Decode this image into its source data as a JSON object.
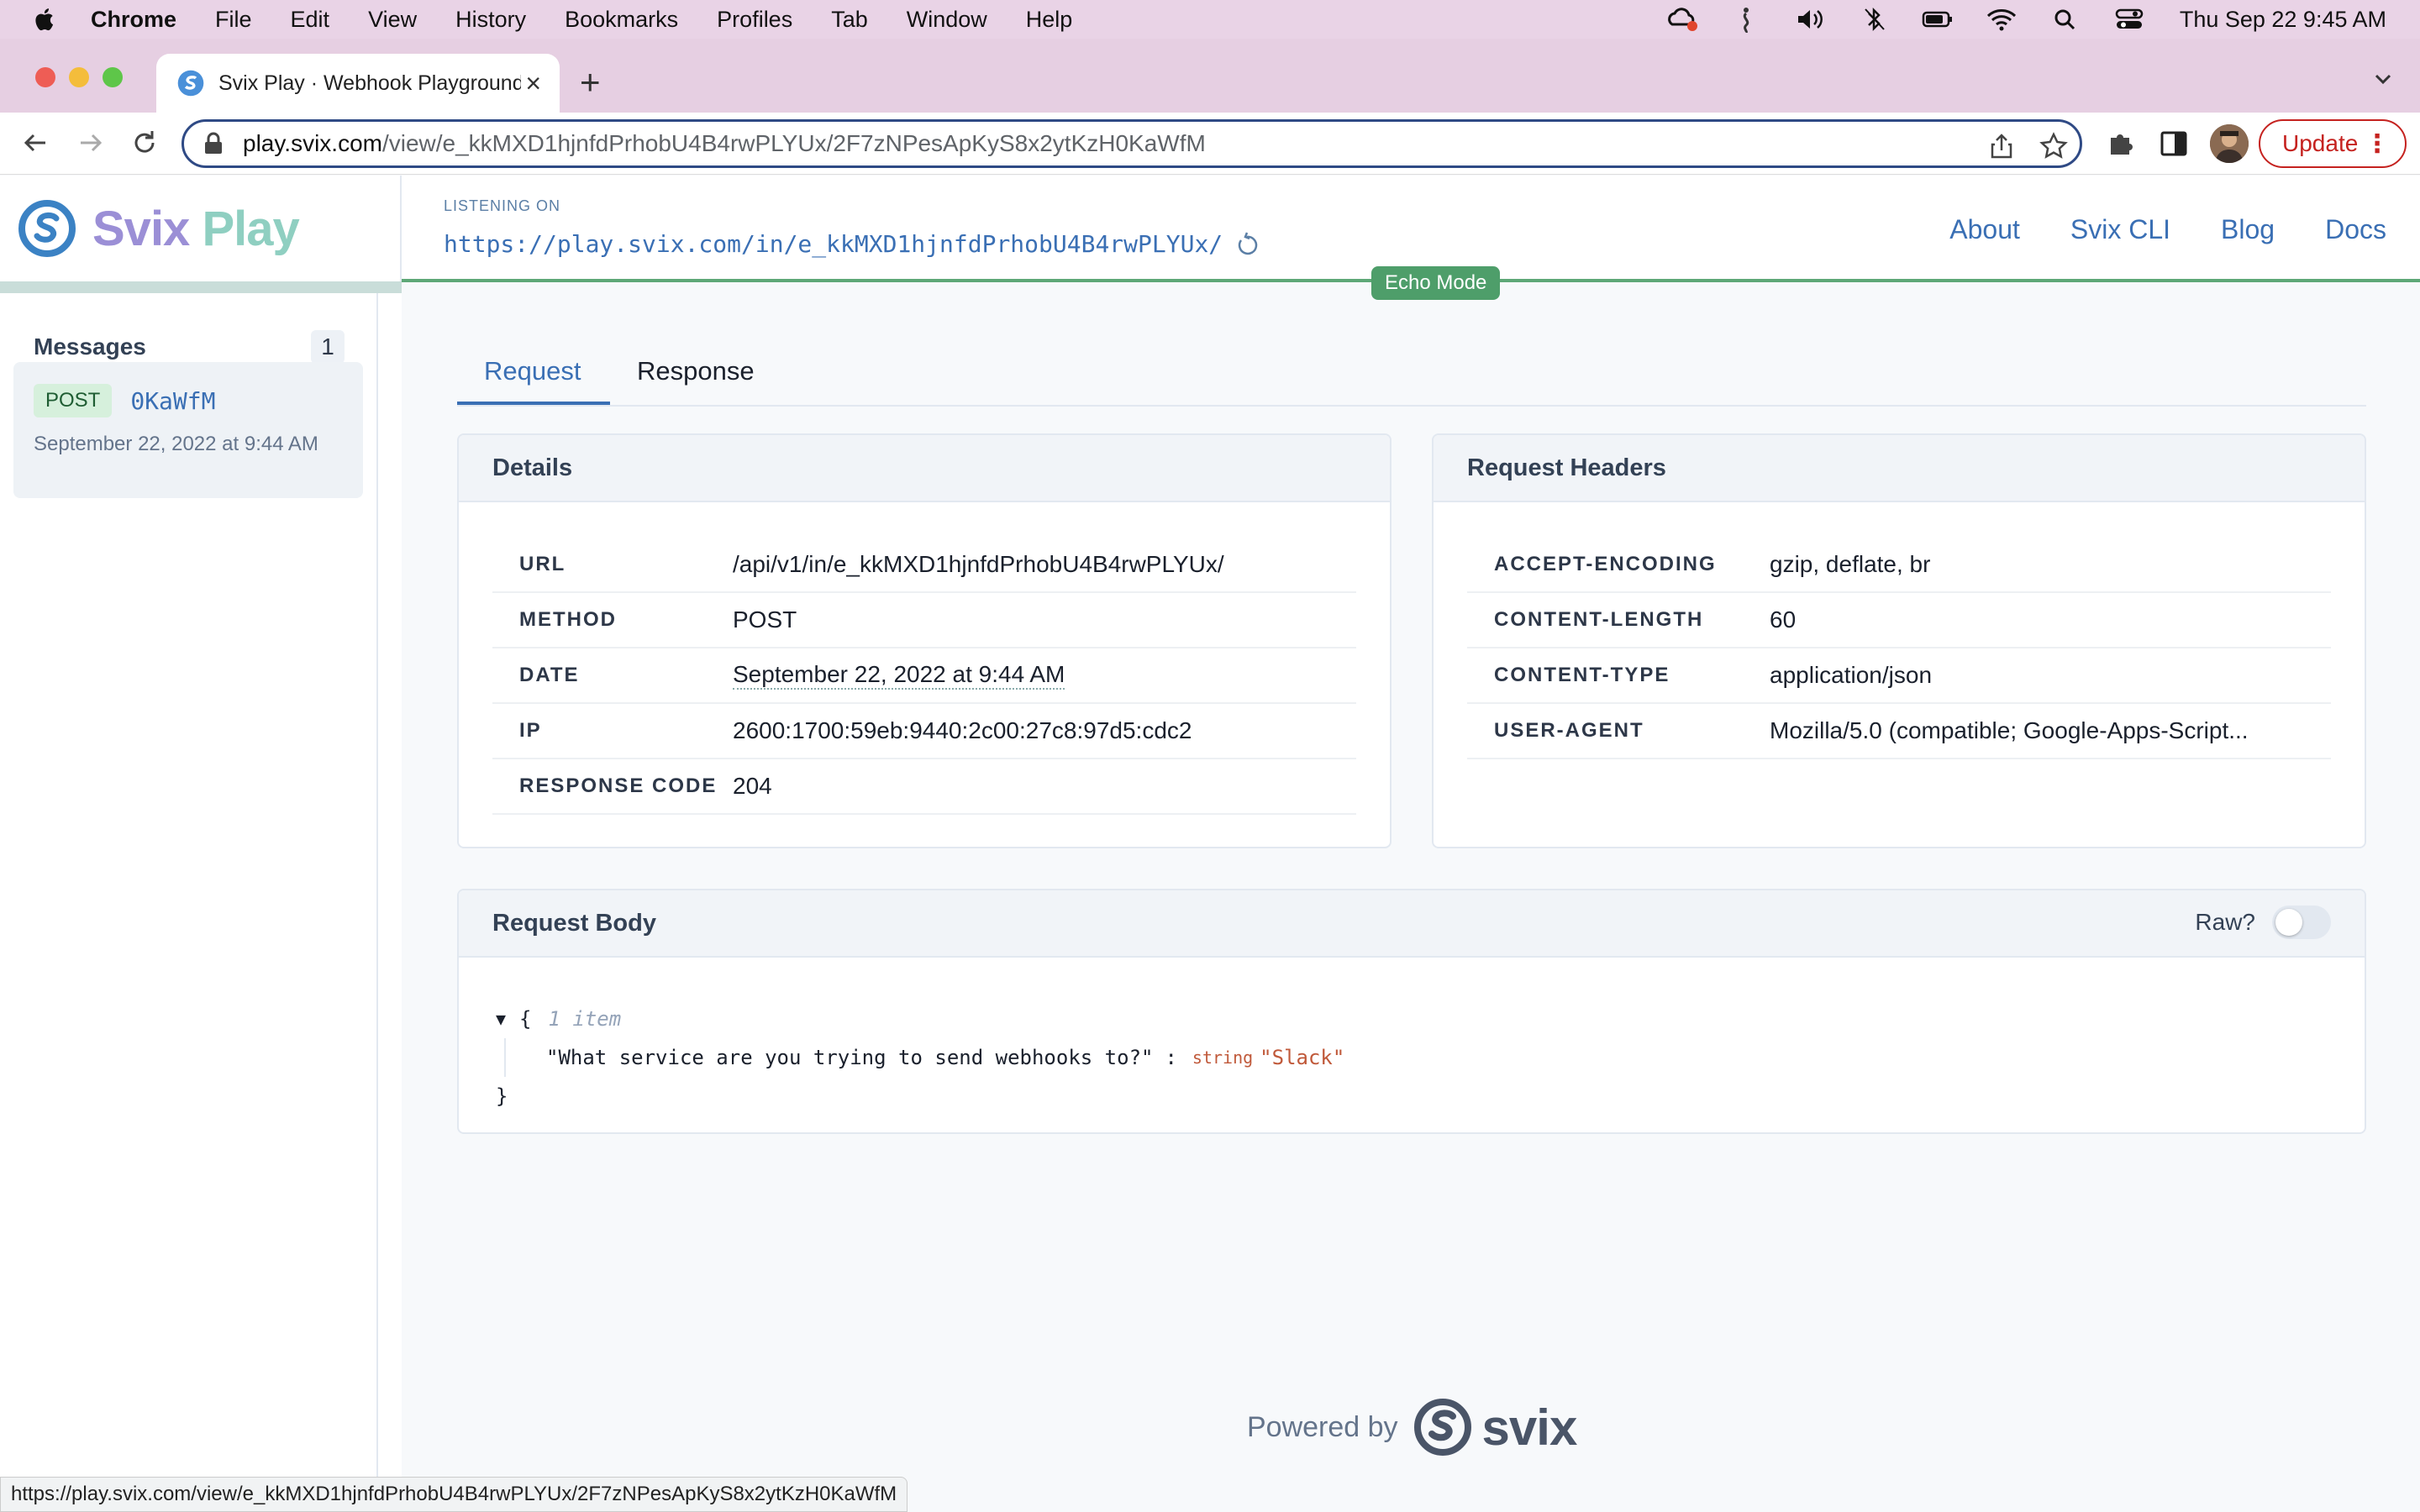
{
  "menubar": {
    "app": "Chrome",
    "items": [
      "File",
      "Edit",
      "View",
      "History",
      "Bookmarks",
      "Profiles",
      "Tab",
      "Window",
      "Help"
    ],
    "clock": "Thu Sep 22  9:45 AM"
  },
  "browser": {
    "tab_title": "Svix Play · Webhook Playground",
    "url_host": "play.svix.com",
    "url_path": "/view/e_kkMXD1hjnfdPrhobU4B4rwPLYUx/2F7zNPesApKyS8x2ytKzH0KaWfM",
    "update_label": "Update",
    "status_url": "https://play.svix.com/view/e_kkMXD1hjnfdPrhobU4B4rwPLYUx/2F7zNPesApKyS8x2ytKzH0KaWfM"
  },
  "header": {
    "brand_first": "Svix",
    "brand_second": "Play",
    "listening_label": "LISTENING ON",
    "listening_url": "https://play.svix.com/in/e_kkMXD1hjnfdPrhobU4B4rwPLYUx/",
    "nav": [
      "About",
      "Svix CLI",
      "Blog",
      "Docs"
    ],
    "echo_mode": "Echo Mode"
  },
  "sidebar": {
    "title": "Messages",
    "count": "1",
    "messages": [
      {
        "method": "POST",
        "id": "0KaWfM",
        "date": "September 22, 2022 at 9:44 AM"
      }
    ]
  },
  "main": {
    "tabs": [
      "Request",
      "Response"
    ],
    "details": {
      "title": "Details",
      "rows": [
        {
          "key": "URL",
          "value": "/api/v1/in/e_kkMXD1hjnfdPrhobU4B4rwPLYUx/"
        },
        {
          "key": "METHOD",
          "value": "POST"
        },
        {
          "key": "DATE",
          "value": "September 22, 2022 at 9:44 AM"
        },
        {
          "key": "IP",
          "value": "2600:1700:59eb:9440:2c00:27c8:97d5:cdc2"
        },
        {
          "key": "RESPONSE CODE",
          "value": "204"
        }
      ]
    },
    "headers": {
      "title": "Request Headers",
      "rows": [
        {
          "key": "ACCEPT-ENCODING",
          "value": "gzip, deflate, br"
        },
        {
          "key": "CONTENT-LENGTH",
          "value": "60"
        },
        {
          "key": "CONTENT-TYPE",
          "value": "application/json"
        },
        {
          "key": "USER-AGENT",
          "value": "Mozilla/5.0 (compatible; Google-Apps-Script..."
        }
      ]
    },
    "body": {
      "title": "Request Body",
      "raw_label": "Raw?",
      "raw_enabled": false,
      "open_brace": "{",
      "item_count": "1 item",
      "json_key": "\"What service are you trying to send webhooks to?\"",
      "colon": ":",
      "type": "string",
      "json_value": "\"Slack\"",
      "close_brace": "}"
    }
  },
  "footer": {
    "powered_by": "Powered by",
    "brand": "svix"
  },
  "colors": {
    "accent": "#3a6fb4",
    "echo": "#4e9e6a",
    "menubar": "#e9d3e6"
  }
}
